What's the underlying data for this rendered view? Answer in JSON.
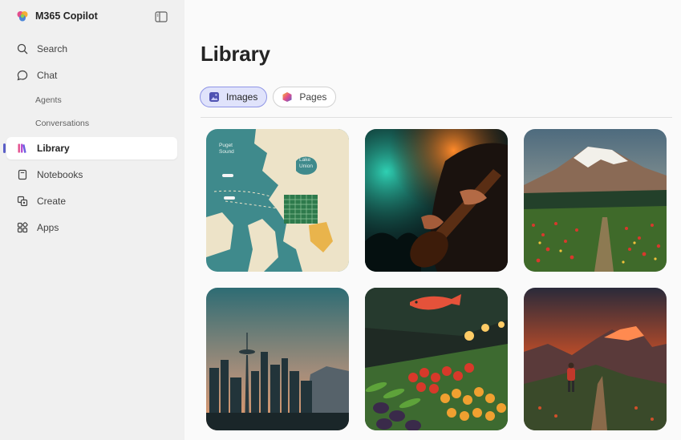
{
  "app": {
    "name": "M365 Copilot"
  },
  "sidebar": {
    "items": [
      {
        "label": "Search",
        "icon": "search-icon"
      },
      {
        "label": "Chat",
        "icon": "chat-icon"
      },
      {
        "label": "Agents"
      },
      {
        "label": "Conversations"
      },
      {
        "label": "Library",
        "icon": "library-icon",
        "active": true
      },
      {
        "label": "Notebooks",
        "icon": "notebook-icon"
      },
      {
        "label": "Create",
        "icon": "create-icon"
      },
      {
        "label": "Apps",
        "icon": "apps-icon"
      }
    ]
  },
  "main": {
    "title": "Library",
    "tabs": [
      {
        "label": "Images",
        "selected": true,
        "icon": "image-icon"
      },
      {
        "label": "Pages",
        "selected": false,
        "icon": "pages-icon"
      }
    ],
    "images": [
      {
        "subject": "map",
        "labels": [
          "Puget",
          "Sound",
          "Lake",
          "Union"
        ]
      },
      {
        "subject": "guitarist"
      },
      {
        "subject": "mountain-meadow"
      },
      {
        "subject": "seattle-skyline"
      },
      {
        "subject": "market"
      },
      {
        "subject": "mountain-hiker"
      }
    ]
  },
  "colors": {
    "accent": "#5b5fc7",
    "sidebar_bg": "#f0f0f0",
    "tab_selected_bg": "#e0e3fb"
  }
}
